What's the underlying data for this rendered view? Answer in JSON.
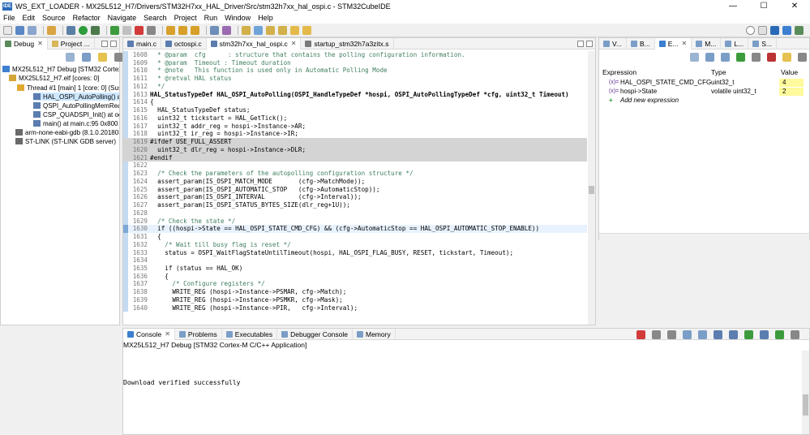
{
  "window": {
    "title": "WS_EXT_LOADER - MX25L512_H7/Drivers/STM32H7xx_HAL_Driver/Src/stm32h7xx_hal_ospi.c - STM32CubeIDE",
    "app_icon": "IDE",
    "minimize": "—",
    "maximize": "☐",
    "close": "✕"
  },
  "menu": [
    "File",
    "Edit",
    "Source",
    "Refactor",
    "Navigate",
    "Search",
    "Project",
    "Run",
    "Window",
    "Help"
  ],
  "left_panel": {
    "tabs": [
      {
        "label": "Debug",
        "icon": "debug-icon"
      },
      {
        "label": "Project ...",
        "icon": "project-explorer-icon"
      }
    ],
    "tree": [
      {
        "label": "MX25L512_H7 Debug [STM32 Cortex-M C/C++ Application]",
        "icon": "launch-icon",
        "indent": 0
      },
      {
        "label": "MX25L512_H7.elf [cores: 0]",
        "icon": "process-icon",
        "indent": 1
      },
      {
        "label": "Thread #1 [main] 1 [core: 0] (Suspended : Breakpoint)",
        "icon": "thread-icon",
        "indent": 2
      },
      {
        "label": "HAL_OSPI_AutoPolling() at stm32h7xx_hal_ospi.c:1630",
        "icon": "stack-frame-icon",
        "indent": 3,
        "selected": true
      },
      {
        "label": "QSPI_AutoPollingMemReady() at octospi.c:152",
        "icon": "stack-frame-icon",
        "indent": 3
      },
      {
        "label": "CSP_QUADSPI_Init() at octospi.c:102",
        "icon": "stack-frame-icon",
        "indent": 3
      },
      {
        "label": "main() at main.c:95 0x800",
        "icon": "stack-frame-icon",
        "indent": 3
      },
      {
        "label": "arm-none-eabi-gdb (8.1.0.20180315)",
        "icon": "gdb-icon",
        "indent": 1
      },
      {
        "label": "ST-LINK (ST-LINK GDB server)",
        "icon": "stlink-icon",
        "indent": 1
      }
    ]
  },
  "editor": {
    "tabs": [
      {
        "label": "main.c",
        "icon": "c-file-icon"
      },
      {
        "label": "octospi.c",
        "icon": "c-file-icon"
      },
      {
        "label": "stm32h7xx_hal_ospi.c",
        "icon": "c-file-icon",
        "active": true,
        "close": "✕"
      },
      {
        "label": "startup_stm32h7a3zitx.s",
        "icon": "asm-file-icon"
      }
    ],
    "lines": [
      {
        "n": "1608",
        "t": "  * @param  cfg      : structure that contains the polling configuration information.",
        "c": "cmt"
      },
      {
        "n": "1609",
        "t": "  * @param  Timeout : Timeout duration",
        "c": "cmt"
      },
      {
        "n": "1610",
        "t": "  * @note   This function is used only in Automatic Polling Mode",
        "c": "cmt"
      },
      {
        "n": "1611",
        "t": "  * @retval HAL status",
        "c": "cmt"
      },
      {
        "n": "1612",
        "t": "  */",
        "c": "cmt"
      },
      {
        "n": "1613",
        "t": "HAL_StatusTypeDef HAL_OSPI_AutoPolling(OSPI_HandleTypeDef *hospi, OSPI_AutoPollingTypeDef *cfg, uint32_t Timeout)",
        "c": "fn"
      },
      {
        "n": "1614",
        "t": "{"
      },
      {
        "n": "1615",
        "t": "  HAL_StatusTypeDef status;"
      },
      {
        "n": "1616",
        "t": "  uint32_t tickstart = HAL_GetTick();"
      },
      {
        "n": "1617",
        "t": "  uint32_t addr_reg = hospi->Instance->AR;"
      },
      {
        "n": "1618",
        "t": "  uint32_t ir_reg = hospi->Instance->IR;"
      },
      {
        "n": "1619",
        "t": "#ifdef USE_FULL_ASSERT",
        "c": "disabled"
      },
      {
        "n": "1620",
        "t": "  uint32_t dlr_reg = hospi->Instance->DLR;",
        "c": "disabled"
      },
      {
        "n": "1621",
        "t": "#endif",
        "c": "disabled"
      },
      {
        "n": "1622",
        "t": ""
      },
      {
        "n": "1623",
        "t": "  /* Check the parameters of the autopolling configuration structure */",
        "c": "cmt"
      },
      {
        "n": "1624",
        "t": "  assert_param(IS_OSPI_MATCH_MODE       (cfg->MatchMode));"
      },
      {
        "n": "1625",
        "t": "  assert_param(IS_OSPI_AUTOMATIC_STOP   (cfg->AutomaticStop));"
      },
      {
        "n": "1626",
        "t": "  assert_param(IS_OSPI_INTERVAL         (cfg->Interval));"
      },
      {
        "n": "1627",
        "t": "  assert_param(IS_OSPI_STATUS_BYTES_SIZE(dlr_reg+1U));"
      },
      {
        "n": "1628",
        "t": ""
      },
      {
        "n": "1629",
        "t": "  /* Check the state */",
        "c": "cmt"
      },
      {
        "n": "1630",
        "t": "  if ((hospi->State == HAL_OSPI_STATE_CMD_CFG) && (cfg->AutomaticStop == HAL_OSPI_AUTOMATIC_STOP_ENABLE))",
        "c": "current"
      },
      {
        "n": "1631",
        "t": "  {"
      },
      {
        "n": "1632",
        "t": "    /* Wait till busy flag is reset */",
        "c": "cmt"
      },
      {
        "n": "1633",
        "t": "    status = OSPI_WaitFlagStateUntilTimeout(hospi, HAL_OSPI_FLAG_BUSY, RESET, tickstart, Timeout);"
      },
      {
        "n": "1634",
        "t": ""
      },
      {
        "n": "1635",
        "t": "    if (status == HAL_OK)"
      },
      {
        "n": "1636",
        "t": "    {"
      },
      {
        "n": "1637",
        "t": "      /* Configure registers */",
        "c": "cmt"
      },
      {
        "n": "1638",
        "t": "      WRITE_REG (hospi->Instance->PSMAR, cfg->Match);"
      },
      {
        "n": "1639",
        "t": "      WRITE_REG (hospi->Instance->PSMKR, cfg->Mask);"
      },
      {
        "n": "1640",
        "t": "      WRITE_REG (hospi->Instance->PIR,   cfg->Interval);"
      }
    ]
  },
  "expressions": {
    "tabs": [
      {
        "label": "V...",
        "icon": "variables-icon"
      },
      {
        "label": "B...",
        "icon": "breakpoints-icon"
      },
      {
        "label": "E...",
        "icon": "expressions-icon",
        "active": true
      },
      {
        "label": "M...",
        "icon": "modules-icon"
      },
      {
        "label": "L...",
        "icon": "live-expressions-icon"
      },
      {
        "label": "S...",
        "icon": "sfr-icon"
      }
    ],
    "headers": {
      "expression": "Expression",
      "type": "Type",
      "value": "Value"
    },
    "rows": [
      {
        "expr": "HAL_OSPI_STATE_CMD_CFG",
        "type": "uint32_t",
        "value": "4"
      },
      {
        "expr": "hospi->State",
        "type": "volatile uint32_t",
        "value": "2"
      }
    ],
    "add_new": "Add new expression"
  },
  "console": {
    "tabs": [
      {
        "label": "Console",
        "icon": "console-icon",
        "active": true
      },
      {
        "label": "Problems",
        "icon": "problems-icon"
      },
      {
        "label": "Executables",
        "icon": "executables-icon"
      },
      {
        "label": "Debugger Console",
        "icon": "debugger-console-icon"
      },
      {
        "label": "Memory",
        "icon": "memory-icon"
      }
    ],
    "subtitle": "MX25L512_H7 Debug [STM32 Cortex-M C/C++ Application]",
    "output": "Download verified successfully"
  },
  "colors": {
    "selection": "#cde8ff",
    "current_line": "#e8f2fe",
    "disabled_block": "#d4d4d4",
    "value_highlight": "#fffa9c",
    "comment": "#3f7f5f",
    "keyword": "#7f0055"
  }
}
